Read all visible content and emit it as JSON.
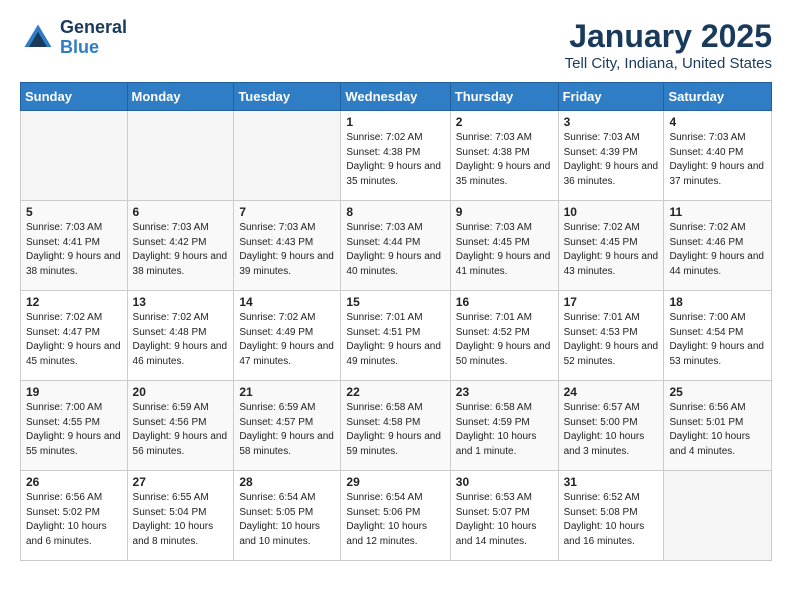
{
  "logo": {
    "general": "General",
    "blue": "Blue"
  },
  "header": {
    "title": "January 2025",
    "subtitle": "Tell City, Indiana, United States"
  },
  "weekdays": [
    "Sunday",
    "Monday",
    "Tuesday",
    "Wednesday",
    "Thursday",
    "Friday",
    "Saturday"
  ],
  "weeks": [
    [
      {
        "day": "",
        "info": ""
      },
      {
        "day": "",
        "info": ""
      },
      {
        "day": "",
        "info": ""
      },
      {
        "day": "1",
        "info": "Sunrise: 7:02 AM\nSunset: 4:38 PM\nDaylight: 9 hours and 35 minutes."
      },
      {
        "day": "2",
        "info": "Sunrise: 7:03 AM\nSunset: 4:38 PM\nDaylight: 9 hours and 35 minutes."
      },
      {
        "day": "3",
        "info": "Sunrise: 7:03 AM\nSunset: 4:39 PM\nDaylight: 9 hours and 36 minutes."
      },
      {
        "day": "4",
        "info": "Sunrise: 7:03 AM\nSunset: 4:40 PM\nDaylight: 9 hours and 37 minutes."
      }
    ],
    [
      {
        "day": "5",
        "info": "Sunrise: 7:03 AM\nSunset: 4:41 PM\nDaylight: 9 hours and 38 minutes."
      },
      {
        "day": "6",
        "info": "Sunrise: 7:03 AM\nSunset: 4:42 PM\nDaylight: 9 hours and 38 minutes."
      },
      {
        "day": "7",
        "info": "Sunrise: 7:03 AM\nSunset: 4:43 PM\nDaylight: 9 hours and 39 minutes."
      },
      {
        "day": "8",
        "info": "Sunrise: 7:03 AM\nSunset: 4:44 PM\nDaylight: 9 hours and 40 minutes."
      },
      {
        "day": "9",
        "info": "Sunrise: 7:03 AM\nSunset: 4:45 PM\nDaylight: 9 hours and 41 minutes."
      },
      {
        "day": "10",
        "info": "Sunrise: 7:02 AM\nSunset: 4:45 PM\nDaylight: 9 hours and 43 minutes."
      },
      {
        "day": "11",
        "info": "Sunrise: 7:02 AM\nSunset: 4:46 PM\nDaylight: 9 hours and 44 minutes."
      }
    ],
    [
      {
        "day": "12",
        "info": "Sunrise: 7:02 AM\nSunset: 4:47 PM\nDaylight: 9 hours and 45 minutes."
      },
      {
        "day": "13",
        "info": "Sunrise: 7:02 AM\nSunset: 4:48 PM\nDaylight: 9 hours and 46 minutes."
      },
      {
        "day": "14",
        "info": "Sunrise: 7:02 AM\nSunset: 4:49 PM\nDaylight: 9 hours and 47 minutes."
      },
      {
        "day": "15",
        "info": "Sunrise: 7:01 AM\nSunset: 4:51 PM\nDaylight: 9 hours and 49 minutes."
      },
      {
        "day": "16",
        "info": "Sunrise: 7:01 AM\nSunset: 4:52 PM\nDaylight: 9 hours and 50 minutes."
      },
      {
        "day": "17",
        "info": "Sunrise: 7:01 AM\nSunset: 4:53 PM\nDaylight: 9 hours and 52 minutes."
      },
      {
        "day": "18",
        "info": "Sunrise: 7:00 AM\nSunset: 4:54 PM\nDaylight: 9 hours and 53 minutes."
      }
    ],
    [
      {
        "day": "19",
        "info": "Sunrise: 7:00 AM\nSunset: 4:55 PM\nDaylight: 9 hours and 55 minutes."
      },
      {
        "day": "20",
        "info": "Sunrise: 6:59 AM\nSunset: 4:56 PM\nDaylight: 9 hours and 56 minutes."
      },
      {
        "day": "21",
        "info": "Sunrise: 6:59 AM\nSunset: 4:57 PM\nDaylight: 9 hours and 58 minutes."
      },
      {
        "day": "22",
        "info": "Sunrise: 6:58 AM\nSunset: 4:58 PM\nDaylight: 9 hours and 59 minutes."
      },
      {
        "day": "23",
        "info": "Sunrise: 6:58 AM\nSunset: 4:59 PM\nDaylight: 10 hours and 1 minute."
      },
      {
        "day": "24",
        "info": "Sunrise: 6:57 AM\nSunset: 5:00 PM\nDaylight: 10 hours and 3 minutes."
      },
      {
        "day": "25",
        "info": "Sunrise: 6:56 AM\nSunset: 5:01 PM\nDaylight: 10 hours and 4 minutes."
      }
    ],
    [
      {
        "day": "26",
        "info": "Sunrise: 6:56 AM\nSunset: 5:02 PM\nDaylight: 10 hours and 6 minutes."
      },
      {
        "day": "27",
        "info": "Sunrise: 6:55 AM\nSunset: 5:04 PM\nDaylight: 10 hours and 8 minutes."
      },
      {
        "day": "28",
        "info": "Sunrise: 6:54 AM\nSunset: 5:05 PM\nDaylight: 10 hours and 10 minutes."
      },
      {
        "day": "29",
        "info": "Sunrise: 6:54 AM\nSunset: 5:06 PM\nDaylight: 10 hours and 12 minutes."
      },
      {
        "day": "30",
        "info": "Sunrise: 6:53 AM\nSunset: 5:07 PM\nDaylight: 10 hours and 14 minutes."
      },
      {
        "day": "31",
        "info": "Sunrise: 6:52 AM\nSunset: 5:08 PM\nDaylight: 10 hours and 16 minutes."
      },
      {
        "day": "",
        "info": ""
      }
    ]
  ]
}
